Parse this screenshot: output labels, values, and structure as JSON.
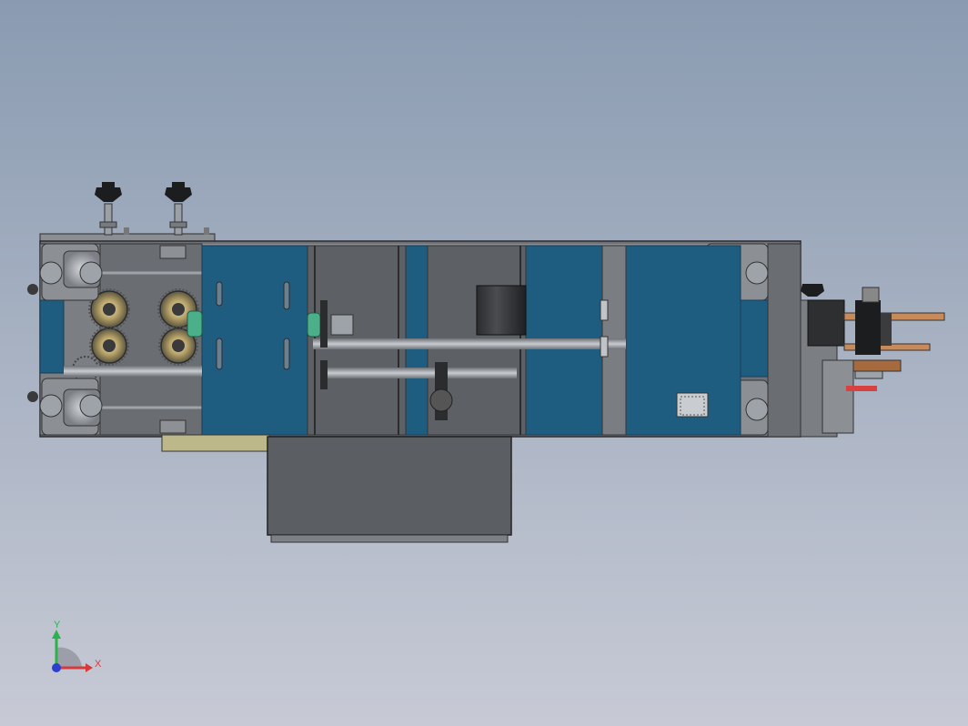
{
  "view": {
    "background_top": "#8a9bb1",
    "background_bottom": "#c7cad5"
  },
  "colors": {
    "frame_gray": "#6e7177",
    "frame_dark": "#3d3f43",
    "panel_blue": "#1f5d80",
    "panel_blue_dark": "#164865",
    "plate_gray": "#5d6064",
    "shaft": "#9ea3a9",
    "gear_gold": "#b9a46a",
    "gear_green": "#4bb08a",
    "knob_black": "#1c1d1f",
    "copper": "#c98a5a",
    "tray_olive": "#bdb889",
    "box_gray": "#5b5e63"
  },
  "triad": {
    "y_label": "Y",
    "x_label": "X",
    "y_color": "#2bb24c",
    "x_color": "#d83a3a",
    "z_color": "#2a3fd0"
  }
}
